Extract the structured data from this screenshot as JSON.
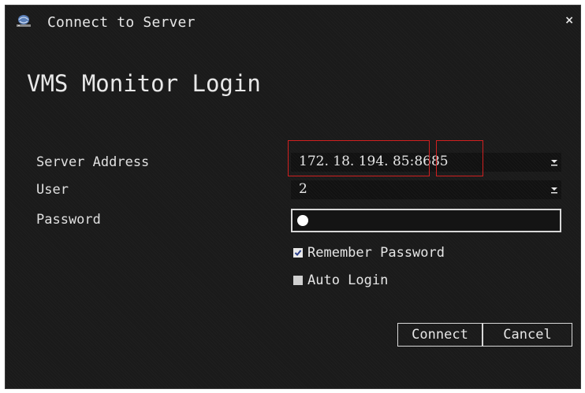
{
  "window": {
    "title": "Connect to Server",
    "close_glyph": "×",
    "icon": "server-globe-icon"
  },
  "form": {
    "heading": "VMS Monitor Login",
    "server_address": {
      "label": "Server Address",
      "ip": "172. 18. 194. 85",
      "separator": ":",
      "port": "8685"
    },
    "user": {
      "label": "User",
      "value": "2"
    },
    "password": {
      "label": "Password",
      "masked_length": 1
    },
    "remember_password": {
      "label": "Remember Password",
      "checked": true
    },
    "auto_login": {
      "label": "Auto Login",
      "checked": false
    }
  },
  "buttons": {
    "connect": "Connect",
    "cancel": "Cancel"
  },
  "colors": {
    "background": "#1a1a1a",
    "text": "#e6e6e6",
    "highlight_box": "#d02020"
  }
}
